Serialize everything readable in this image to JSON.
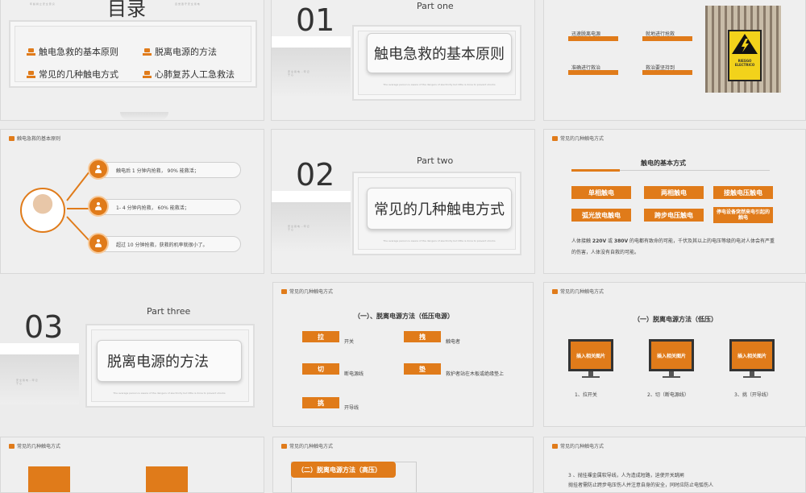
{
  "slide1": {
    "toc_title": "目录",
    "tiny_left": "年 龄 树 立 安 全 意 识",
    "tiny_right": "自 觉 遵 守 安 全 用 电",
    "items": [
      "触电急救的基本原则",
      "脱离电源的方法",
      "常见的几种触电方式",
      "心肺复苏人工急救法"
    ]
  },
  "slide2": {
    "num": "01",
    "part": "Part one",
    "title": "触电急救的基本原则",
    "tiny": "The average person is aware of the dangers of electricity but little is done to prevent shocks"
  },
  "slide3": {
    "labels": [
      "迅速脱离电源",
      "就地进行抢救",
      "准确进行救治",
      "救治要坚持到"
    ],
    "sign_line1": "RIESGO",
    "sign_line2": "ELECTRICO"
  },
  "slide4": {
    "header": "触电急救的基本原则",
    "rows": [
      "触电后 1 分钟内抢救， 90% 能救活；",
      "1- 4 分钟内抢救， 60% 能救活；",
      "超过 10 分钟抢救，获救的机率就很小了。"
    ]
  },
  "slide5": {
    "num": "02",
    "part": "Part two",
    "title": "常见的几种触电方式",
    "tiny": "The average person is aware of the dangers of electricity but little is done to prevent shocks"
  },
  "slide6": {
    "header": "常见的几种触电方式",
    "subtitle": "触电的基本方式",
    "buttons": [
      "单相触电",
      "两相触电",
      "接触电压触电",
      "弧光放电触电",
      "跨步电压触电",
      "停电设备突然来电引起的触电"
    ],
    "body_pre": "人体接触 ",
    "v1": "220V",
    "body_mid1": " 或 ",
    "v2": "380V",
    "body_post": " 的电都有致命的可能，千伏及其以上的电压等级的电对人体会有严重的伤害，人体没有自救的可能。"
  },
  "slide7": {
    "num": "03",
    "part": "Part three",
    "title": "脱离电源的方法",
    "tiny": "The average person is aware of the dangers of electricity but little is done to prevent shocks"
  },
  "slide8": {
    "header": "常见的几种触电方式",
    "title": "（一）、脱离电源方法（低压电源）",
    "items": [
      {
        "key": "拉",
        "text": "开关"
      },
      {
        "key": "拽",
        "text": "触电者"
      },
      {
        "key": "切",
        "text": "断电源线"
      },
      {
        "key": "垫",
        "text": "救护者站在木板或绝缘垫上"
      },
      {
        "key": "挑",
        "text": "开导线"
      }
    ]
  },
  "slide9": {
    "header": "常见的几种触电方式",
    "title": "（一）脱离电源方法（低压）",
    "screens": [
      "插入相关图片",
      "插入相关图片",
      "插入相关图片"
    ],
    "captions": [
      "1、拉开关",
      "2、切（断电源线）",
      "3、挑（开导线）"
    ]
  },
  "slide10": {
    "header": "常见的几种触电方式"
  },
  "slide11": {
    "header": "常见的几种触电方式",
    "tab": "（二）脱离电源方法（高压）"
  },
  "slide12": {
    "header": "常见的几种触电方式",
    "line1": "3 、抛挂裸金属软导线，人为造成短路，迫使开关跳闸",
    "line2": "抛挂者需防止跨步电压伤人并注意自身的安全，同时应防止电弧伤人"
  }
}
